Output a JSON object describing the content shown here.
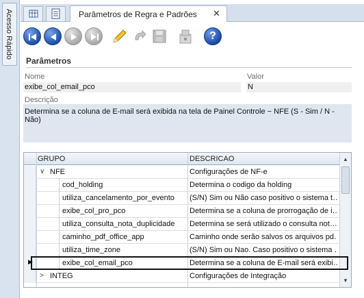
{
  "sidebar": {
    "quick_access_label": "Acesso Rápido"
  },
  "tabs": {
    "active_label": "Parâmetros de Regra e Padrões",
    "close_glyph": "✕"
  },
  "toolbar": {
    "buttons": [
      {
        "name": "first-record",
        "icon": "first-icon",
        "enabled": true
      },
      {
        "name": "previous-record",
        "icon": "previous-icon",
        "enabled": true
      },
      {
        "name": "next-record",
        "icon": "next-icon",
        "enabled": false
      },
      {
        "name": "last-record",
        "icon": "last-icon",
        "enabled": false
      },
      {
        "name": "edit",
        "icon": "pencil-icon",
        "enabled": true
      },
      {
        "name": "undo",
        "icon": "undo-icon",
        "enabled": false
      },
      {
        "name": "save",
        "icon": "save-icon",
        "enabled": false
      },
      {
        "name": "lock",
        "icon": "lock-icon",
        "enabled": false
      },
      {
        "name": "help",
        "icon": "help-icon",
        "enabled": true
      }
    ],
    "help_glyph": "?"
  },
  "params": {
    "section_title": "Parâmetros",
    "name_label": "Nome",
    "name_value": "exibe_col_email_pco",
    "value_label": "Valor",
    "value_value": "N",
    "desc_label": "Descrição",
    "desc_value": "Determina se a coluna de E-mail será exibida na tela de Painel Controle − NFE (S - Sim / N -Não)"
  },
  "grid": {
    "headers": {
      "group": "GRUPO",
      "description": "DESCRICAO"
    },
    "rows": [
      {
        "name": "NFE",
        "desc": "Configurações de NF-e",
        "level": 0,
        "expander": "∨"
      },
      {
        "name": "cod_holding",
        "desc": "Determina o codigo da holding",
        "level": 1
      },
      {
        "name": "utiliza_cancelamento_por_evento",
        "desc": "(S/N) Sim ou Não caso positivo o sistema t…",
        "level": 1
      },
      {
        "name": "exibe_col_pro_pco",
        "desc": "Determina se a coluna de prorrogação de i…",
        "level": 1
      },
      {
        "name": "utiliza_consulta_nota_duplicidade",
        "desc": "Determina se será utilizado o consulta not…",
        "level": 1
      },
      {
        "name": "caminho_pdf_office_app",
        "desc": "Caminho onde serão salvos os arquivos pd…",
        "level": 1
      },
      {
        "name": "utiliza_time_zone",
        "desc": "(S/N) Sim ou Nao. Caso positivo o sistema …",
        "level": 1
      },
      {
        "name": "exibe_col_email_pco",
        "desc": "Determina se a coluna de E-mail será exibi…",
        "level": 1,
        "selected": true
      },
      {
        "name": "INTEG",
        "desc": "Configurações de Integração",
        "level": 0,
        "expander": ">"
      }
    ],
    "row_indicator": "▶"
  },
  "colors": {
    "accent": "#1d4fa8",
    "panel_bg": "#d6e0ec",
    "desc_bg": "#dfe6ef"
  }
}
